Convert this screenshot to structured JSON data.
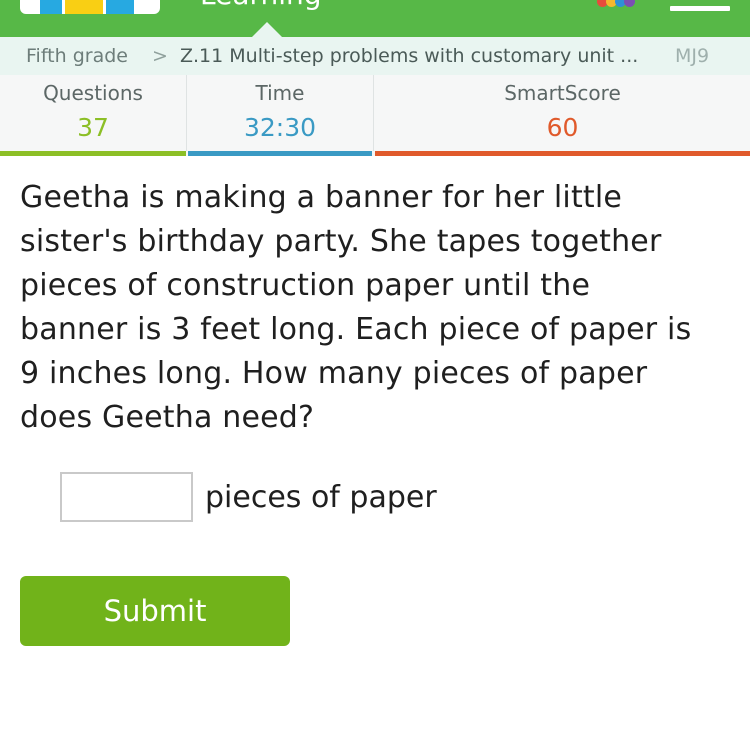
{
  "header": {
    "brand_label": "Learning",
    "colors": {
      "bar": "#57b847",
      "logo_blue": "#27a9e1",
      "logo_yellow": "#f9cf14"
    },
    "icons": [
      "ixl-logo",
      "awards-icon",
      "menu-icon"
    ]
  },
  "breadcrumb": {
    "grade": "Fifth grade",
    "separator": ">",
    "skill": "Z.11 Multi-step problems with customary unit ...",
    "code": "MJ9"
  },
  "stats": {
    "questions": {
      "label": "Questions",
      "value": "37",
      "color": "#8cbf26"
    },
    "time": {
      "label": "Time",
      "value": "32:30",
      "color": "#3a9ac4"
    },
    "smartscore": {
      "label": "SmartScore",
      "value": "60",
      "color": "#e05a2b"
    }
  },
  "question": {
    "lines": [
      "Geetha is making a banner for her little",
      "sister's birthday party. She tapes together",
      "pieces of construction paper until the",
      "banner is 3 feet long. Each piece of paper is",
      "9 inches long. How many pieces of paper",
      "does Geetha need?"
    ]
  },
  "answer": {
    "value": "",
    "placeholder": "",
    "unit": "pieces of paper"
  },
  "submit": {
    "label": "Submit",
    "color": "#71b31a"
  }
}
